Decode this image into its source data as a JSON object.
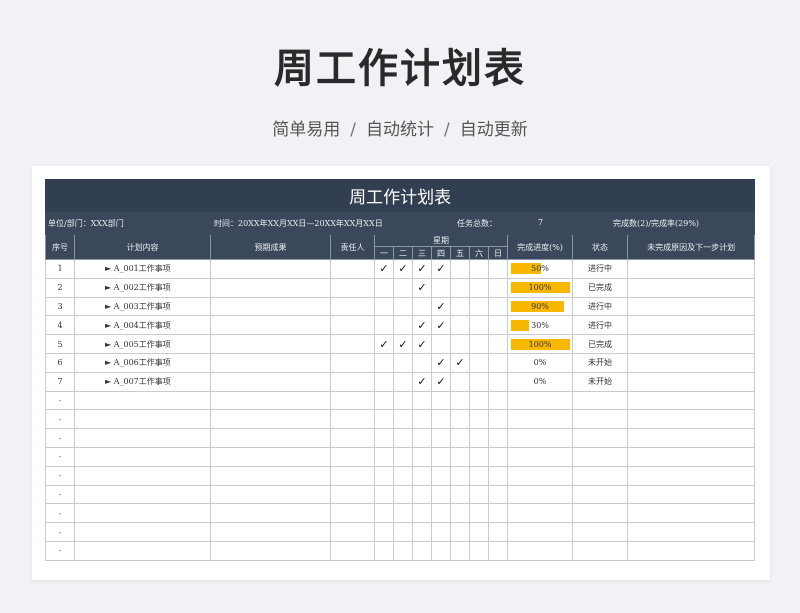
{
  "hero": {
    "title": "周工作计划表",
    "sub_parts": [
      "简单易用",
      "自动统计",
      "自动更新"
    ],
    "separator": "/"
  },
  "sheet": {
    "title": "周工作计划表",
    "info": {
      "dept": "单位/部门：XXX部门",
      "time": "时间：20XX年XX月XX日—20XX年XX月XX日",
      "total_label": "任务总数：",
      "total_value": "7",
      "done_summary": "完成数(2)/完成率(29%)"
    },
    "headers": {
      "index": "序号",
      "content": "计划内容",
      "result": "预期成果",
      "owner": "责任人",
      "week": "星期",
      "days": [
        "一",
        "二",
        "三",
        "四",
        "五",
        "六",
        "日"
      ],
      "progress": "完成进度(%)",
      "status": "状态",
      "reason": "未完成原因及下一步计划"
    },
    "rows": [
      {
        "index": "1",
        "content": "► A_001工作事项",
        "days": [
          true,
          true,
          true,
          true,
          false,
          false,
          false
        ],
        "progress": 50,
        "progress_label": "50%",
        "status": "进行中"
      },
      {
        "index": "2",
        "content": "► A_002工作事项",
        "days": [
          false,
          false,
          true,
          false,
          false,
          false,
          false
        ],
        "progress": 100,
        "progress_label": "100%",
        "status": "已完成"
      },
      {
        "index": "3",
        "content": "► A_003工作事项",
        "days": [
          false,
          false,
          false,
          true,
          false,
          false,
          false
        ],
        "progress": 90,
        "progress_label": "90%",
        "status": "进行中"
      },
      {
        "index": "4",
        "content": "► A_004工作事项",
        "days": [
          false,
          false,
          true,
          true,
          false,
          false,
          false
        ],
        "progress": 30,
        "progress_label": "30%",
        "status": "进行中"
      },
      {
        "index": "5",
        "content": "► A_005工作事项",
        "days": [
          true,
          true,
          true,
          false,
          false,
          false,
          false
        ],
        "progress": 100,
        "progress_label": "100%",
        "status": "已完成"
      },
      {
        "index": "6",
        "content": "► A_006工作事项",
        "days": [
          false,
          false,
          false,
          true,
          true,
          false,
          false
        ],
        "progress": 0,
        "progress_label": "0%",
        "status": "未开始"
      },
      {
        "index": "7",
        "content": "► A_007工作事项",
        "days": [
          false,
          false,
          true,
          true,
          false,
          false,
          false
        ],
        "progress": 0,
        "progress_label": "0%",
        "status": "未开始"
      }
    ],
    "empty_marker": "-",
    "empty_row_count": 9,
    "check_glyph": "✓",
    "colors": {
      "header_bg": "#323f52",
      "progress_bar": "#f8b800"
    }
  }
}
